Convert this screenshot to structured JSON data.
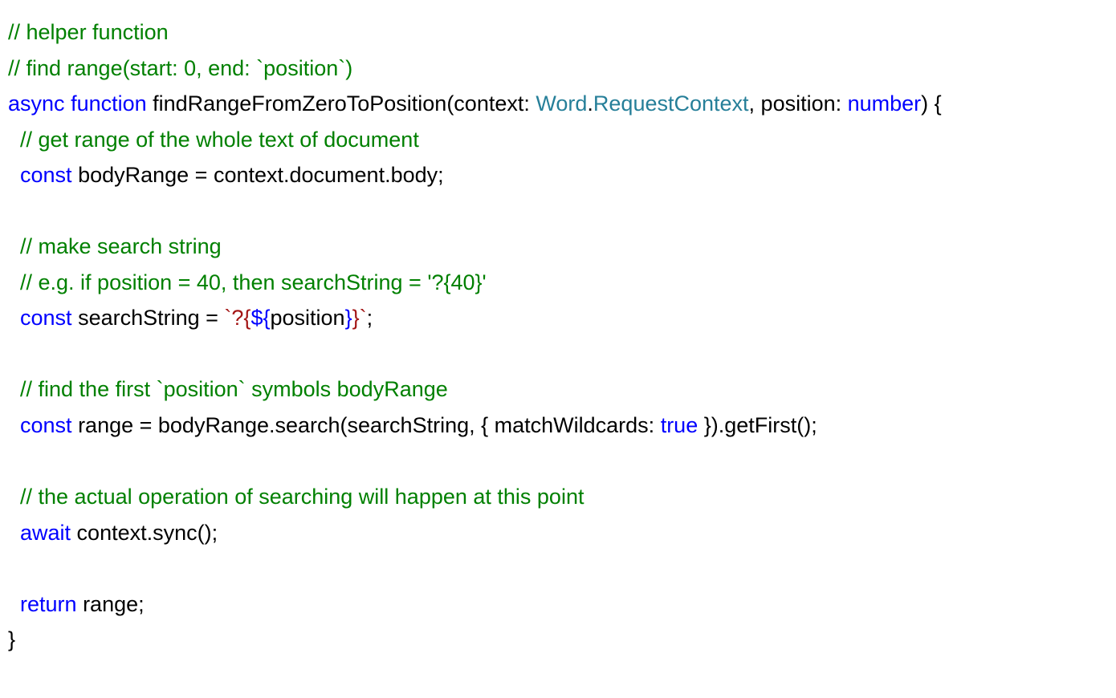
{
  "code": {
    "line1_comment": "// helper function",
    "line2_comment": "// find range(start: 0, end: `position`)",
    "kw_async": "async",
    "kw_function": "function",
    "fn_name": " findRangeFromZeroToPosition(context: ",
    "type_word": "Word",
    "dot": ".",
    "type_req": "RequestContext",
    "after_type": ", position: ",
    "type_number": "number",
    "sig_close": ") {",
    "line4_comment": "  // get range of the whole text of document",
    "kw_const1": "  const",
    "line5_rest": " bodyRange = context.document.body;",
    "line7_comment": "  // make search string",
    "line8_comment": "  // e.g. if position = 40, then searchString = '?{40}'",
    "kw_const2": "  const",
    "line9_rest_a": " searchString = ",
    "str_open": "`?{",
    "interp_open": "${",
    "interp_body": "position",
    "interp_close": "}",
    "str_close": "}`",
    "line9_semi": ";",
    "line11_comment": "  // find the first `position` symbols bodyRange",
    "kw_const3": "  const",
    "line12_rest_a": " range = bodyRange.search(searchString, { matchWildcards: ",
    "kw_true": "true",
    "line12_rest_b": " }).getFirst();",
    "line14_comment": "  // the actual operation of searching will happen at this point",
    "kw_await": "  await",
    "line15_rest": " context.sync();",
    "kw_return": "  return",
    "line17_rest": " range;",
    "close_brace": "}"
  }
}
